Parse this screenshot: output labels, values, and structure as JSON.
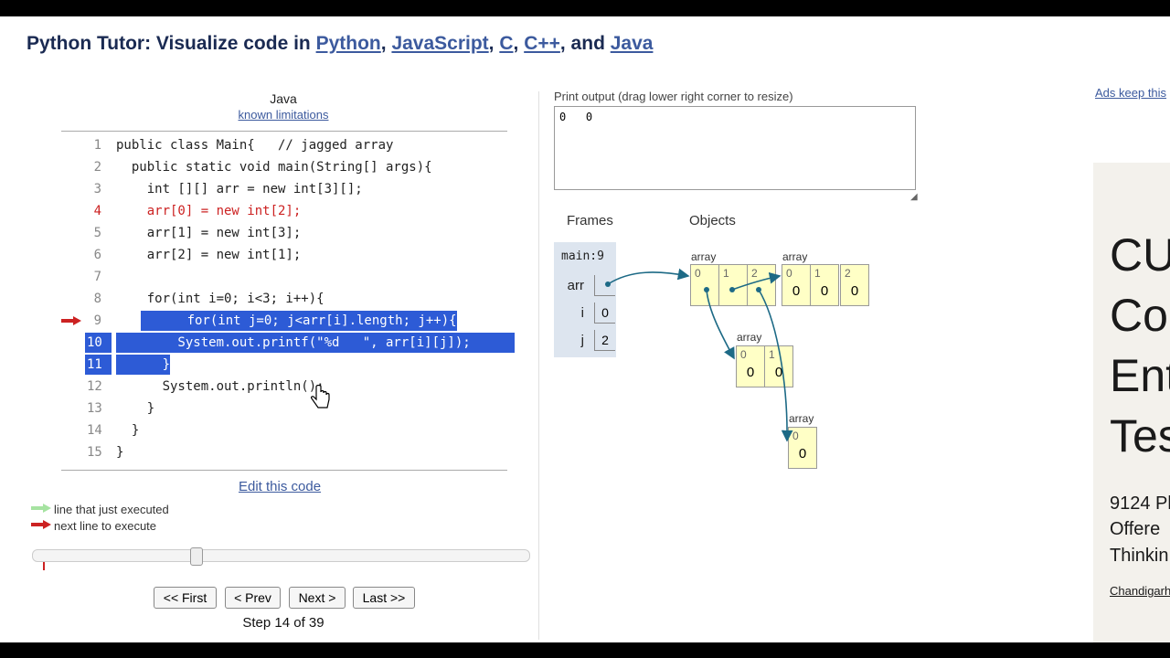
{
  "header": {
    "prefix": "Python Tutor: Visualize code in ",
    "links": [
      "Python",
      "JavaScript",
      "C",
      "C++",
      "Java"
    ],
    "sep1": ", ",
    "sep2": ", ",
    "sep3": ", ",
    "sep4": ", and "
  },
  "editor": {
    "language": "Java",
    "limitations_link": "known limitations",
    "lines": [
      {
        "num": "1",
        "text": "public class Main{   // jagged array"
      },
      {
        "num": "2",
        "text": "  public static void main(String[] args){"
      },
      {
        "num": "3",
        "text": "    int [][] arr = new int[3][];"
      },
      {
        "num": "4",
        "text": "    arr[0] = new int[2];"
      },
      {
        "num": "5",
        "text": "    arr[1] = new int[3];"
      },
      {
        "num": "6",
        "text": "    arr[2] = new int[1];"
      },
      {
        "num": "7",
        "text": ""
      },
      {
        "num": "8",
        "text": "    for(int i=0; i<3; i++){"
      },
      {
        "num": "9",
        "text": "      for(int j=0; j<arr[i].length; j++){"
      },
      {
        "num": "10",
        "text": "        System.out.printf(\"%d   \", arr[i][j]);"
      },
      {
        "num": "11",
        "text": "      }"
      },
      {
        "num": "12",
        "text": "      System.out.println();"
      },
      {
        "num": "13",
        "text": "    }"
      },
      {
        "num": "14",
        "text": "  }"
      },
      {
        "num": "15",
        "text": "}"
      }
    ],
    "edit_link": "Edit this code"
  },
  "legend": {
    "just_executed": "line that just executed",
    "next_line": "next line to execute",
    "green_color": "#a6e3a1",
    "red_color": "#c22"
  },
  "navigation": {
    "first": "<< First",
    "prev": "< Prev",
    "next": "Next >",
    "last": "Last >>",
    "step_text": "Step 14 of 39",
    "progress": 0.333
  },
  "output": {
    "label": "Print output (drag lower right corner to resize)",
    "text": "0   0"
  },
  "visualization": {
    "frames_header": "Frames",
    "objects_header": "Objects",
    "frame_name": "main:9",
    "variables": [
      {
        "name": "arr",
        "value": ""
      },
      {
        "name": "i",
        "value": "0"
      },
      {
        "name": "j",
        "value": "2"
      }
    ],
    "array_label": "array",
    "outer_indices": [
      "0",
      "1",
      "2"
    ],
    "array_a": {
      "indices": [
        "0",
        "1",
        "2"
      ],
      "values": [
        "0",
        "0",
        "0"
      ]
    },
    "array_b": {
      "indices": [
        "0",
        "1"
      ],
      "values": [
        "0",
        "0"
      ]
    },
    "array_c": {
      "indices": [
        "0"
      ],
      "values": [
        "0"
      ]
    }
  },
  "ad": {
    "keep_link": "Ads keep this",
    "big1": "CU",
    "big2": "Co",
    "big3": "Ent",
    "big4": "Tes",
    "small1": "9124 Pl",
    "small2": "Offere",
    "small3": "Thinkin",
    "location": "Chandigarh"
  }
}
